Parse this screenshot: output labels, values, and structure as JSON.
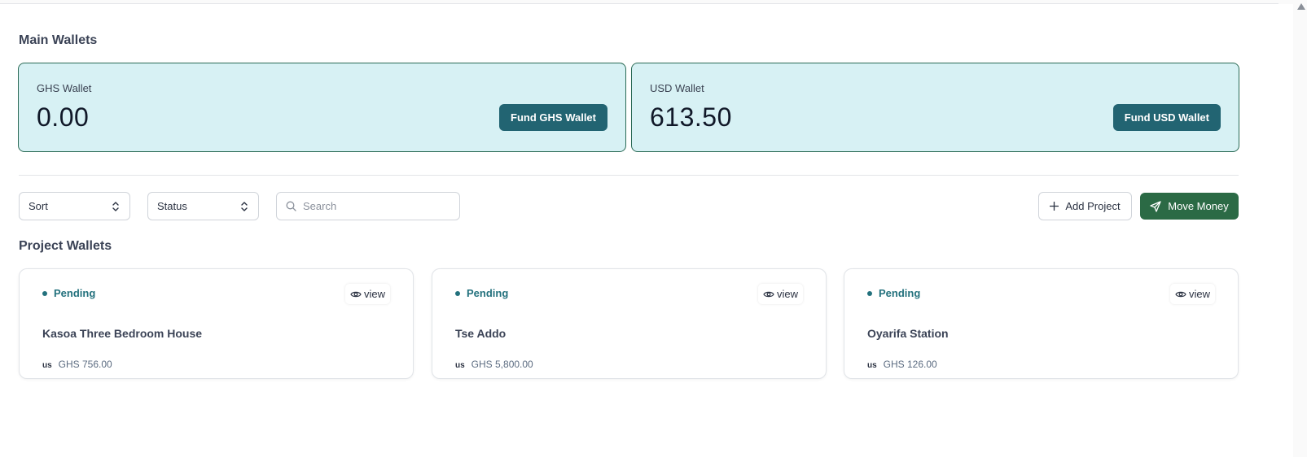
{
  "main_wallets": {
    "title": "Main Wallets",
    "ghs": {
      "label": "GHS Wallet",
      "amount": "0.00",
      "button": "Fund GHS Wallet"
    },
    "usd": {
      "label": "USD Wallet",
      "amount": "613.50",
      "button": "Fund USD Wallet"
    }
  },
  "filters": {
    "sort": "Sort",
    "status": "Status",
    "search_placeholder": "Search"
  },
  "actions": {
    "add_project": "Add Project",
    "move_money": "Move Money"
  },
  "project_wallets": {
    "title": "Project Wallets",
    "items": [
      {
        "status": "Pending",
        "view": "view",
        "name": "Kasoa Three Bedroom House",
        "currency_badge": "us",
        "amount": "GHS 756.00"
      },
      {
        "status": "Pending",
        "view": "view",
        "name": "Tse Addo",
        "currency_badge": "us",
        "amount": "GHS 5,800.00"
      },
      {
        "status": "Pending",
        "view": "view",
        "name": "Oyarifa Station",
        "currency_badge": "us",
        "amount": "GHS 126.00"
      }
    ]
  },
  "colors": {
    "wallet_card_bg": "#d7f1f4",
    "wallet_card_border": "#2a6a55",
    "fund_button": "#226472",
    "move_money_button": "#2b6a45",
    "status_pending": "#23717d"
  },
  "icons": {
    "select_chevron": "chevron-up-down-icon",
    "search": "search-icon",
    "add": "plus-icon",
    "move": "send-icon",
    "view": "eye-icon"
  }
}
